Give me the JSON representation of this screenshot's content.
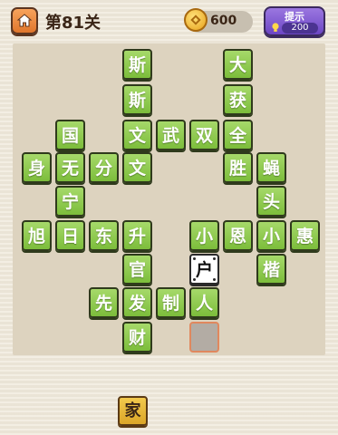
{
  "header": {
    "level_title": "第81关",
    "coins": "600",
    "hint_label": "提示",
    "hint_cost": "200"
  },
  "board": {
    "cells": [
      {
        "c": "斯",
        "type": "green"
      },
      {
        "c": "大",
        "type": "green"
      },
      {
        "c": "斯",
        "type": "green"
      },
      {
        "c": "获",
        "type": "green"
      },
      {
        "c": "国",
        "type": "green"
      },
      {
        "c": "文",
        "type": "green"
      },
      {
        "c": "武",
        "type": "green"
      },
      {
        "c": "双",
        "type": "green"
      },
      {
        "c": "全",
        "type": "green"
      },
      {
        "c": "身",
        "type": "green"
      },
      {
        "c": "无",
        "type": "green"
      },
      {
        "c": "分",
        "type": "green"
      },
      {
        "c": "文",
        "type": "green"
      },
      {
        "c": "胜",
        "type": "green"
      },
      {
        "c": "蝇",
        "type": "green"
      },
      {
        "c": "宁",
        "type": "green"
      },
      {
        "c": "头",
        "type": "green"
      },
      {
        "c": "旭",
        "type": "green"
      },
      {
        "c": "日",
        "type": "green"
      },
      {
        "c": "东",
        "type": "green"
      },
      {
        "c": "升",
        "type": "green"
      },
      {
        "c": "小",
        "type": "green"
      },
      {
        "c": "恩",
        "type": "green"
      },
      {
        "c": "小",
        "type": "green"
      },
      {
        "c": "惠",
        "type": "green"
      },
      {
        "c": "官",
        "type": "green"
      },
      {
        "c": "户",
        "type": "filled"
      },
      {
        "c": "楷",
        "type": "green"
      },
      {
        "c": "先",
        "type": "green"
      },
      {
        "c": "发",
        "type": "green"
      },
      {
        "c": "制",
        "type": "green"
      },
      {
        "c": "人",
        "type": "green"
      },
      {
        "c": "财",
        "type": "green"
      },
      {
        "c": "",
        "type": "empty"
      }
    ]
  },
  "tray": {
    "letters": [
      "家"
    ]
  }
}
